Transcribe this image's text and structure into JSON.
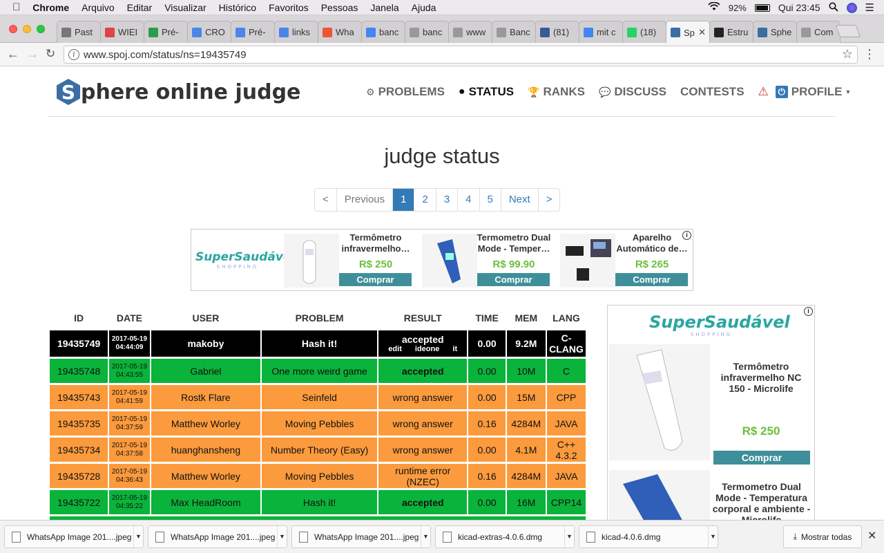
{
  "menubar": {
    "apple": "",
    "app": "Chrome",
    "items": [
      "Arquivo",
      "Editar",
      "Visualizar",
      "Histórico",
      "Favoritos",
      "Pessoas",
      "Janela",
      "Ajuda"
    ],
    "battery": "92%",
    "clock": "Qui 23:45"
  },
  "tabs": [
    {
      "label": "Past",
      "icon": "doc-icon",
      "color": "#777"
    },
    {
      "label": "WIEI",
      "icon": "gmail-icon",
      "color": "#d44"
    },
    {
      "label": "Pré-",
      "icon": "drive-icon",
      "color": "#2a9d4a"
    },
    {
      "label": "CRO",
      "icon": "docs-icon",
      "color": "#4a86e8"
    },
    {
      "label": "Pré-",
      "icon": "docs-icon",
      "color": "#4a86e8"
    },
    {
      "label": "links",
      "icon": "docs-icon",
      "color": "#4a86e8"
    },
    {
      "label": "Wha",
      "icon": "warning-icon",
      "color": "#e53"
    },
    {
      "label": "banc",
      "icon": "google-icon",
      "color": "#4285f4"
    },
    {
      "label": "banc",
      "icon": "page-icon",
      "color": "#999"
    },
    {
      "label": "www",
      "icon": "google-icon",
      "color": "#999"
    },
    {
      "label": "Banc",
      "icon": "page-icon",
      "color": "#999"
    },
    {
      "label": "(81)",
      "icon": "facebook-icon",
      "color": "#3b5998"
    },
    {
      "label": "mit c",
      "icon": "google-icon",
      "color": "#4285f4"
    },
    {
      "label": "(18)",
      "icon": "whatsapp-icon",
      "color": "#25d366"
    },
    {
      "label": "Sp",
      "icon": "spoj-icon",
      "color": "#3a6ea5"
    },
    {
      "label": "Estru",
      "icon": "github-icon",
      "color": "#222"
    },
    {
      "label": "Sphe",
      "icon": "spoj-icon",
      "color": "#3a6ea5"
    },
    {
      "label": "Com",
      "icon": "page-icon",
      "color": "#999"
    }
  ],
  "address": {
    "url": "www.spoj.com/status/ns=19435749"
  },
  "site": {
    "logo_letter": "S",
    "logo_text": "phere online judge",
    "nav": [
      {
        "label": "PROBLEMS",
        "icon": "puzzle-icon"
      },
      {
        "label": "STATUS",
        "icon": "circle-icon"
      },
      {
        "label": "RANKS",
        "icon": "trophy-icon"
      },
      {
        "label": "DISCUSS",
        "icon": "chat-icon"
      },
      {
        "label": "CONTESTS",
        "icon": ""
      },
      {
        "label": "PROFILE",
        "icon": "power-icon"
      }
    ],
    "page_title": "judge status"
  },
  "pagination": [
    "<",
    "Previous",
    "1",
    "2",
    "3",
    "4",
    "5",
    "Next",
    ">"
  ],
  "ad_banner": {
    "brand": "SuperSaudável",
    "brand_sub": "SHOPPING",
    "products": [
      {
        "name": "Termômetro infravermelho…",
        "price": "R$ 250",
        "button": "Comprar"
      },
      {
        "name": "Termometro Dual Mode - Temper…",
        "price": "R$ 99.90",
        "button": "Comprar"
      },
      {
        "name": "Aparelho Automático de…",
        "price": "R$ 265",
        "button": "Comprar"
      }
    ]
  },
  "status_table": {
    "headers": [
      "ID",
      "DATE",
      "USER",
      "PROBLEM",
      "RESULT",
      "TIME",
      "MEM",
      "LANG"
    ],
    "rows": [
      {
        "id": "19435749",
        "date": "2017-05-19",
        "time_of_day": "04:44:09",
        "user": "makoby",
        "problem": "Hash it!",
        "result": "accepted",
        "result_links": "edit ideone it",
        "time": "0.00",
        "mem": "9.2M",
        "lang": "C-CLANG",
        "status": "black"
      },
      {
        "id": "19435748",
        "date": "2017-05-19",
        "time_of_day": "04:43:55",
        "user": "Gabriel",
        "problem": "One more weird game",
        "result": "accepted",
        "time": "0.00",
        "mem": "10M",
        "lang": "C",
        "status": "green"
      },
      {
        "id": "19435743",
        "date": "2017-05-19",
        "time_of_day": "04:41:59",
        "user": "Rostk Flare",
        "problem": "Seinfeld",
        "result": "wrong answer",
        "time": "0.00",
        "mem": "15M",
        "lang": "CPP",
        "status": "orange"
      },
      {
        "id": "19435735",
        "date": "2017-05-19",
        "time_of_day": "04:37:59",
        "user": "Matthew Worley",
        "problem": "Moving Pebbles",
        "result": "wrong answer",
        "time": "0.16",
        "mem": "4284M",
        "lang": "JAVA",
        "status": "orange"
      },
      {
        "id": "19435734",
        "date": "2017-05-19",
        "time_of_day": "04:37:58",
        "user": "huanghansheng",
        "problem": "Number Theory (Easy)",
        "result": "wrong answer",
        "time": "0.00",
        "mem": "4.1M",
        "lang": "C++ 4.3.2",
        "status": "orange"
      },
      {
        "id": "19435728",
        "date": "2017-05-19",
        "time_of_day": "04:36:43",
        "user": "Matthew Worley",
        "problem": "Moving Pebbles",
        "result": "runtime error (NZEC)",
        "time": "0.16",
        "mem": "4284M",
        "lang": "JAVA",
        "status": "orange"
      },
      {
        "id": "19435722",
        "date": "2017-05-19",
        "time_of_day": "04:35:22",
        "user": "Max HeadRoom",
        "problem": "Hash it!",
        "result": "accepted",
        "time": "0.00",
        "mem": "16M",
        "lang": "CPP14",
        "status": "green"
      }
    ]
  },
  "side_ad": {
    "brand": "SuperSaudável",
    "brand_sub": "SHOPPING",
    "product1": {
      "name": "Termômetro infravermelho NC 150 - Microlife",
      "price": "R$ 250",
      "button": "Comprar"
    },
    "product2": {
      "name": "Termometro Dual Mode - Temperatura corporal e ambiente - Microlife"
    }
  },
  "downloads": {
    "items": [
      "WhatsApp Image 201....jpeg",
      "WhatsApp Image 201....jpeg",
      "WhatsApp Image 201....jpeg",
      "kicad-extras-4.0.6.dmg",
      "kicad-4.0.6.dmg"
    ],
    "show_all": "Mostrar todas"
  },
  "colors": {
    "accepted": "#0ab33a",
    "wrong": "#fb9b3e",
    "link": "#337ab7",
    "brand": "#3a6ea5"
  }
}
